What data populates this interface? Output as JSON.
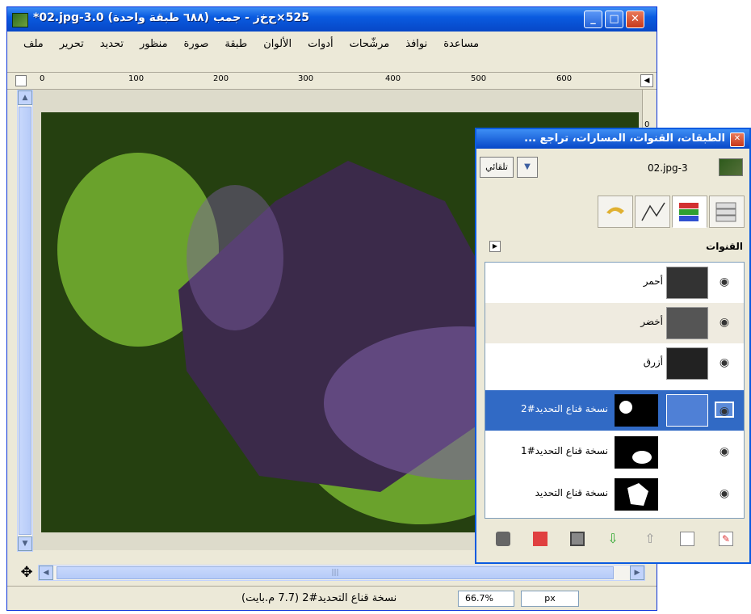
{
  "window": {
    "title": "*02.jpg-3.0 (٦٨٨ طبقة واحدة) 525×ح‌خ‌ز - جمب",
    "minimize_label": "_",
    "maximize_label": "□",
    "close_label": "✕"
  },
  "menu": [
    "ملف",
    "تحرير",
    "تحديد",
    "منظور",
    "صورة",
    "طبقة",
    "الألوان",
    "أدوات",
    "مرشّحات",
    "نوافذ",
    "مساعدة"
  ],
  "ruler": {
    "ticks": [
      "0",
      "100",
      "200",
      "300",
      "400",
      "500",
      "600"
    ],
    "vertical_tick": "0"
  },
  "statusbar": {
    "unit": "px",
    "zoom": "66.7%",
    "message": "نسخة قناع التحديد#2 (7.7 م.بايت)"
  },
  "dock": {
    "title": "الطبقات، القنوات، المسارات، تراجع ...",
    "auto_button": "تلقائي",
    "image_name": "02.jpg-3",
    "section_title": "القنوات",
    "channels": [
      {
        "name": "أحمر"
      },
      {
        "name": "أخضر"
      },
      {
        "name": "أزرق"
      }
    ],
    "masks": [
      {
        "name": "نسخة قناع التحديد#2"
      },
      {
        "name": "نسخة قناع التحديد#1"
      },
      {
        "name": "نسخة قناع التحديد"
      }
    ]
  },
  "colors": {
    "canvas_bg": "#254010",
    "circle": "#6aa22c",
    "flower": "#3b2a4a",
    "selection": "#316ac5"
  }
}
